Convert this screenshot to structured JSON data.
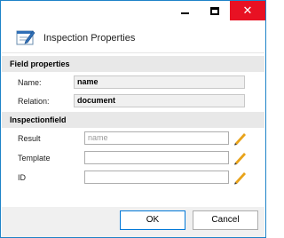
{
  "window": {
    "minimize_icon": "minimize-icon",
    "maximize_icon": "maximize-icon",
    "close_icon": "close-icon",
    "close_glyph": "✕",
    "close_color": "#e81123",
    "border_color": "#1e83c8"
  },
  "header": {
    "icon": "properties-dialog-icon",
    "title": "Inspection Properties"
  },
  "field_properties": {
    "heading": "Field properties",
    "name_label": "Name:",
    "name_value": "name",
    "relation_label": "Relation:",
    "relation_value": "document"
  },
  "inspection_field": {
    "heading": "Inspectionfield",
    "rows": [
      {
        "label": "Result",
        "value": "",
        "placeholder": "name",
        "edit_icon": "pencil-icon"
      },
      {
        "label": "Template",
        "value": "",
        "placeholder": "",
        "edit_icon": "pencil-icon"
      },
      {
        "label": "ID",
        "value": "",
        "placeholder": "",
        "edit_icon": "pencil-icon"
      }
    ],
    "pencil_color": "#e8a31a"
  },
  "footer": {
    "ok_label": "OK",
    "cancel_label": "Cancel",
    "ok_border_color": "#0078d7"
  }
}
